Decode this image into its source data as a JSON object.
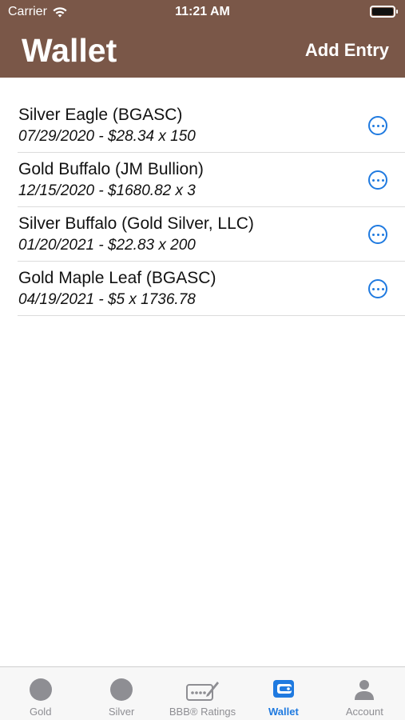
{
  "status": {
    "carrier": "Carrier",
    "time": "11:21 AM"
  },
  "nav": {
    "title": "Wallet",
    "action": "Add Entry"
  },
  "entries": [
    {
      "title": "Silver Eagle (BGASC)",
      "detail": "07/29/2020 - $28.34 x 150"
    },
    {
      "title": "Gold Buffalo (JM Bullion)",
      "detail": "12/15/2020 - $1680.82 x 3"
    },
    {
      "title": "Silver Buffalo (Gold Silver, LLC)",
      "detail": "01/20/2021 - $22.83 x 200"
    },
    {
      "title": "Gold Maple Leaf (BGASC)",
      "detail": "04/19/2021 - $5 x 1736.78"
    }
  ],
  "tabs": [
    {
      "label": "Gold",
      "icon": "coin-icon"
    },
    {
      "label": "Silver",
      "icon": "coin-icon"
    },
    {
      "label": "BBB® Ratings",
      "icon": "ratings-card-icon"
    },
    {
      "label": "Wallet",
      "icon": "wallet-icon"
    },
    {
      "label": "Account",
      "icon": "person-icon"
    }
  ],
  "colors": {
    "header": "#7a5748",
    "accent": "#1f7ae0",
    "inactive": "#8e8e93"
  }
}
